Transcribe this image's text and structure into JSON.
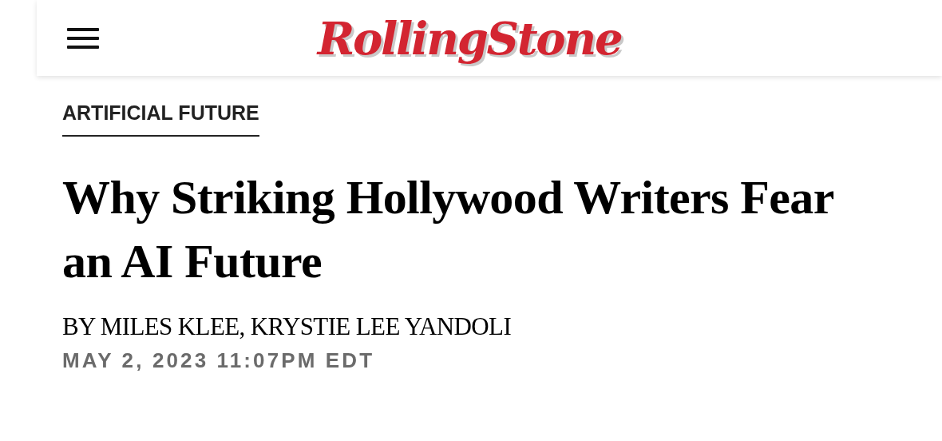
{
  "header": {
    "logo": "RollingStone"
  },
  "article": {
    "category": "ARTIFICIAL FUTURE",
    "headline": "Why Striking Hollywood Writers Fear an AI Future",
    "byline": "BY MILES KLEE, KRYSTIE LEE YANDOLI",
    "date": "MAY 2, 2023 11:07PM EDT"
  }
}
